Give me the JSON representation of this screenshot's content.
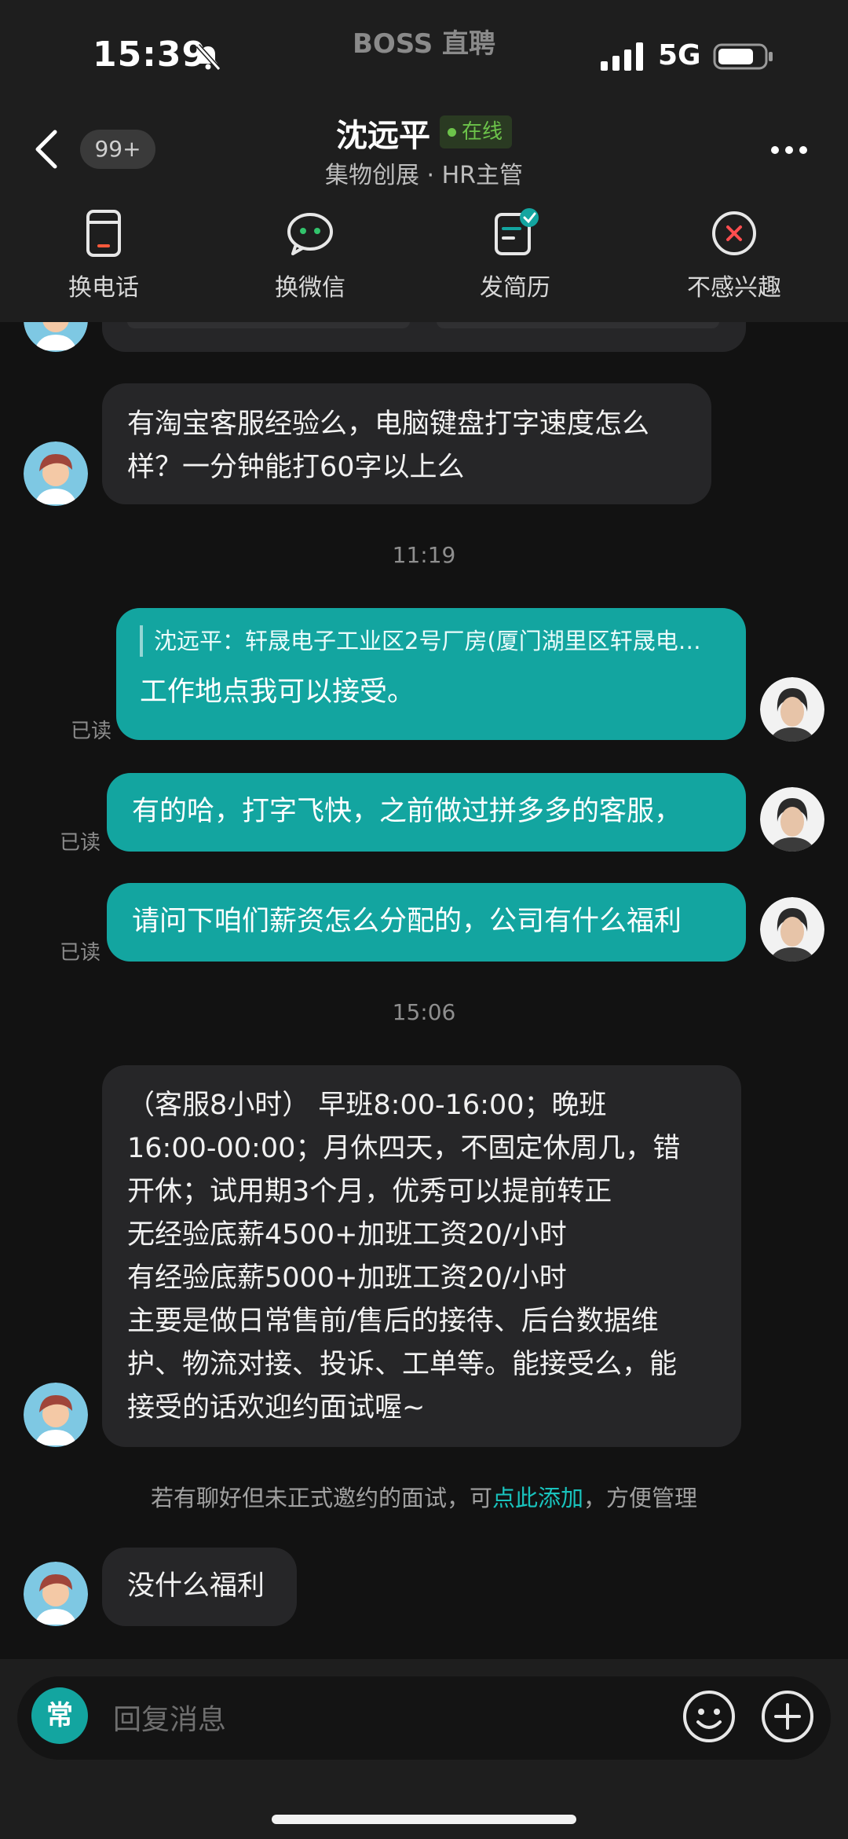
{
  "status_bar": {
    "time": "15:39",
    "app_watermark": "BOSS 直聘",
    "network": "5G"
  },
  "header": {
    "unread_badge": "99+",
    "contact_name": "沈远平",
    "online_label": "在线",
    "contact_subtitle": "集物创展 · HR主管"
  },
  "actions": [
    {
      "label": "换电话",
      "icon": "phone-card-icon"
    },
    {
      "label": "换微信",
      "icon": "wechat-icon"
    },
    {
      "label": "发简历",
      "icon": "resume-icon"
    },
    {
      "label": "不感兴趣",
      "icon": "not-interested-icon"
    }
  ],
  "messages": {
    "m1": {
      "line1": "有淘宝客服经验么，电脑键盘打字速度怎么",
      "line2": "样？一分钟能打60字以上么"
    },
    "time1": "11:19",
    "m2": {
      "quote": "沈远平：轩晟电子工业区2号厂房(厦门湖里区轩晟电…",
      "text": "工作地点我可以接受。",
      "read": "已读"
    },
    "m3": {
      "text": "有的哈，打字飞快，之前做过拼多多的客服，",
      "read": "已读"
    },
    "m4": {
      "text": "请问下咱们薪资怎么分配的，公司有什么福利",
      "read": "已读"
    },
    "time2": "15:06",
    "m5": {
      "lines": [
        "（客服8小时） 早班8:00-16:00；晚班",
        "16:00-00:00；月休四天，不固定休周几，错",
        "开休；试用期3个月，优秀可以提前转正",
        "无经验底薪4500+加班工资20/小时",
        "有经验底薪5000+加班工资20/小时",
        "主要是做日常售前/售后的接待、后台数据维",
        "护、物流对接、投诉、工单等。能接受么，能",
        "接受的话欢迎约面试喔~"
      ]
    },
    "tip": {
      "before": "若有聊好但未正式邀约的面试，可",
      "link": "点此添加",
      "after": "，方便管理"
    },
    "m6": {
      "text": "没什么福利"
    }
  },
  "composer": {
    "quick_label": "常",
    "placeholder": "回复消息"
  },
  "colors": {
    "accent": "#13a5a0",
    "bubble_in": "#262628",
    "background": "#121212",
    "online": "#6cc34a"
  }
}
